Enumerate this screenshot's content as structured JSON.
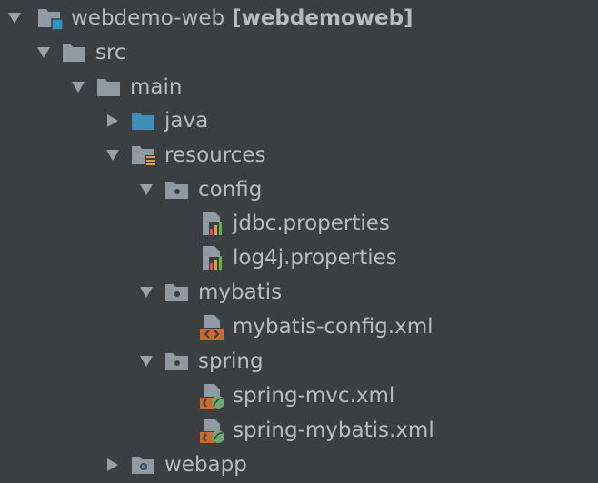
{
  "tree": {
    "root": {
      "label": "webdemo-web",
      "module_name": "[webdemoweb]",
      "icon": "module-folder-icon",
      "expanded": true
    },
    "src": {
      "label": "src",
      "icon": "folder-icon",
      "expanded": true
    },
    "main": {
      "label": "main",
      "icon": "folder-icon",
      "expanded": true
    },
    "java": {
      "label": "java",
      "icon": "source-root-folder-icon",
      "expanded": false
    },
    "resources": {
      "label": "resources",
      "icon": "resources-root-folder-icon",
      "expanded": true
    },
    "config": {
      "label": "config",
      "icon": "package-folder-icon",
      "expanded": true
    },
    "jdbc": {
      "label": "jdbc.properties",
      "icon": "properties-file-icon"
    },
    "log4j": {
      "label": "log4j.properties",
      "icon": "properties-file-icon"
    },
    "mybatis": {
      "label": "mybatis",
      "icon": "package-folder-icon",
      "expanded": true
    },
    "mybatis_config": {
      "label": "mybatis-config.xml",
      "icon": "xml-file-icon"
    },
    "spring": {
      "label": "spring",
      "icon": "package-folder-icon",
      "expanded": true
    },
    "spring_mvc": {
      "label": "spring-mvc.xml",
      "icon": "spring-xml-file-icon"
    },
    "spring_mybatis": {
      "label": "spring-mybatis.xml",
      "icon": "spring-xml-file-icon"
    },
    "webapp": {
      "label": "webapp",
      "icon": "web-folder-icon",
      "expanded": false
    }
  },
  "colors": {
    "background": "#3c3f41",
    "text": "#bbbbbb",
    "folder": "#8f9aa3",
    "source_root": "#3d8fb8",
    "module_badge": "#3592c4",
    "properties_bar_red": "#d9534f",
    "properties_bar_orange": "#e09c3c",
    "properties_bar_green": "#62b543",
    "xml_orange": "#cc6a33",
    "spring_green": "#6aab73",
    "resources_lines": "#d9a13b"
  }
}
